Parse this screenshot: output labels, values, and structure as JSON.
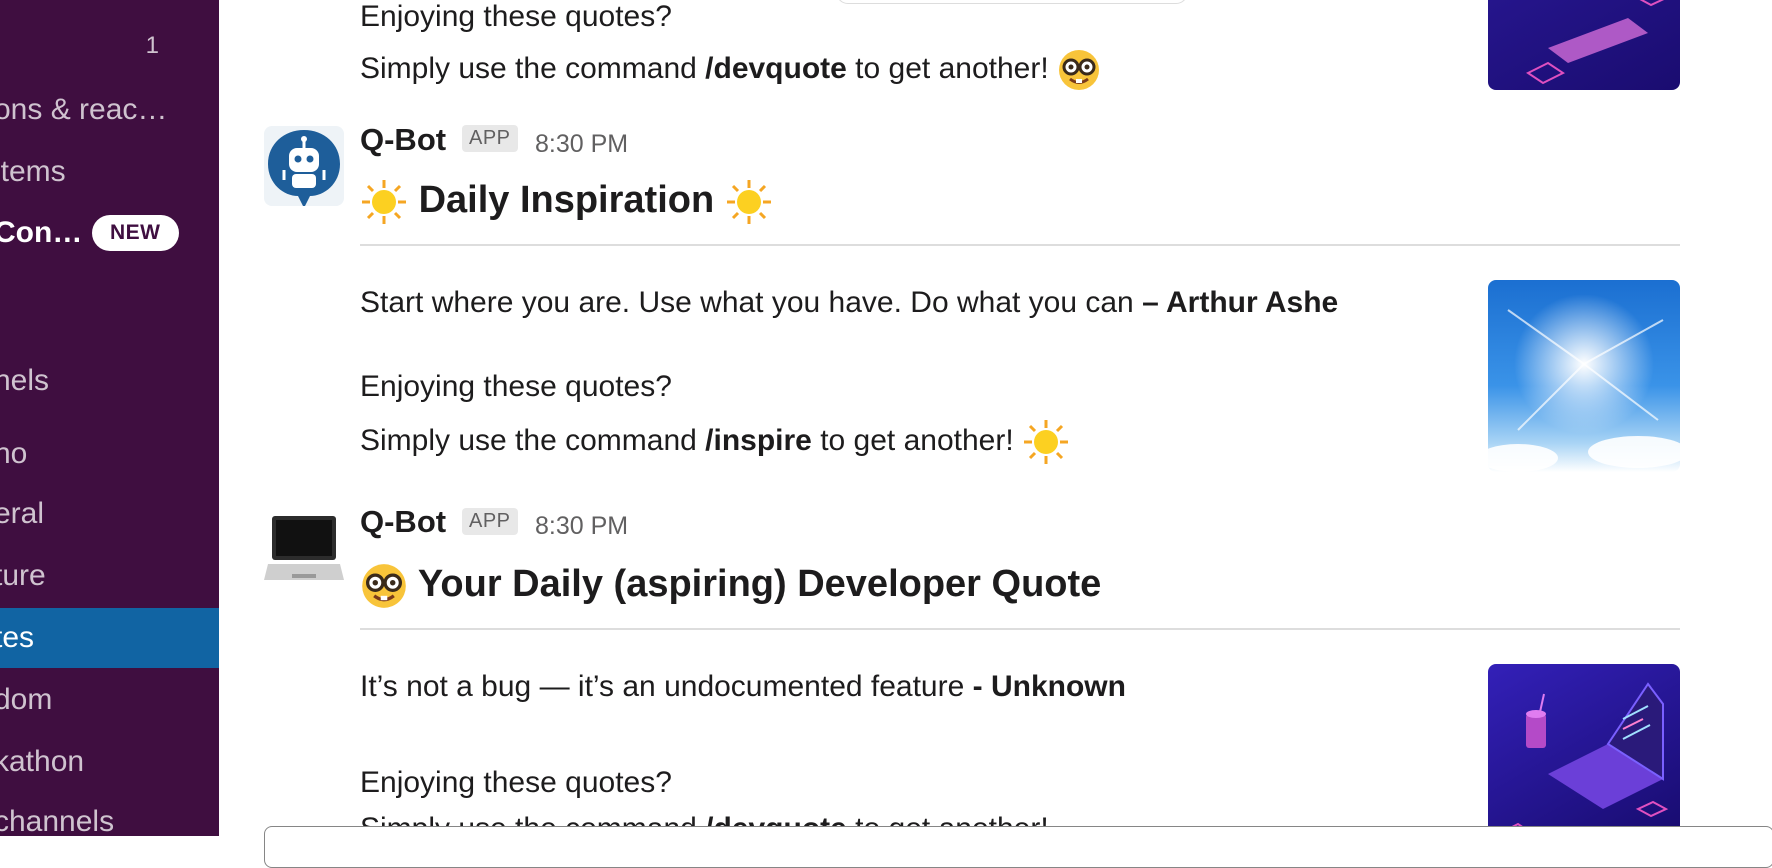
{
  "sidebar": {
    "unread_count": "1",
    "items": [
      {
        "label": "ons & reac…"
      },
      {
        "label": " items"
      },
      {
        "label": "Con…",
        "badge": "NEW"
      },
      {
        "label": "nels"
      },
      {
        "label": "no"
      },
      {
        "label": "eral"
      },
      {
        "label": "ture"
      },
      {
        "label": "tes"
      },
      {
        "label": "dom"
      },
      {
        "label": "kathon"
      },
      {
        "label": " channels"
      }
    ]
  },
  "messages": {
    "partial_top": {
      "enjoying": "Enjoying these quotes?",
      "cmd_prefix": "Simply use the command ",
      "cmd": "/devquote",
      "cmd_suffix": " to get another! "
    },
    "msg1": {
      "author": "Q-Bot",
      "badge": "APP",
      "time": "8:30 PM",
      "heading": "Daily Inspiration",
      "quote": "Start where you are. Use what you have. Do what you can ",
      "quote_author": "– Arthur Ashe",
      "enjoying": "Enjoying these quotes?",
      "cmd_prefix": "Simply use the command ",
      "cmd": "/inspire",
      "cmd_suffix": " to get another! "
    },
    "msg2": {
      "author": "Q-Bot",
      "badge": "APP",
      "time": "8:30 PM",
      "heading": "Your Daily (aspiring) Developer Quote",
      "quote": "It’s not a bug — it’s an undocumented feature ",
      "quote_author": "- Unknown",
      "enjoying": "Enjoying these quotes?",
      "cmd_prefix": "Simply use the command ",
      "cmd": "/devquote",
      "cmd_suffix": " to get another! "
    }
  },
  "colors": {
    "sidebar_bg": "#3f0e40",
    "sidebar_active": "#1164a3",
    "text": "#1d1c1d",
    "muted": "#616061"
  },
  "icons": [
    "nerd-face-emoji",
    "sun-emoji",
    "robot-avatar",
    "laptop-avatar",
    "laptop-isometric-image",
    "sky-sun-image"
  ]
}
